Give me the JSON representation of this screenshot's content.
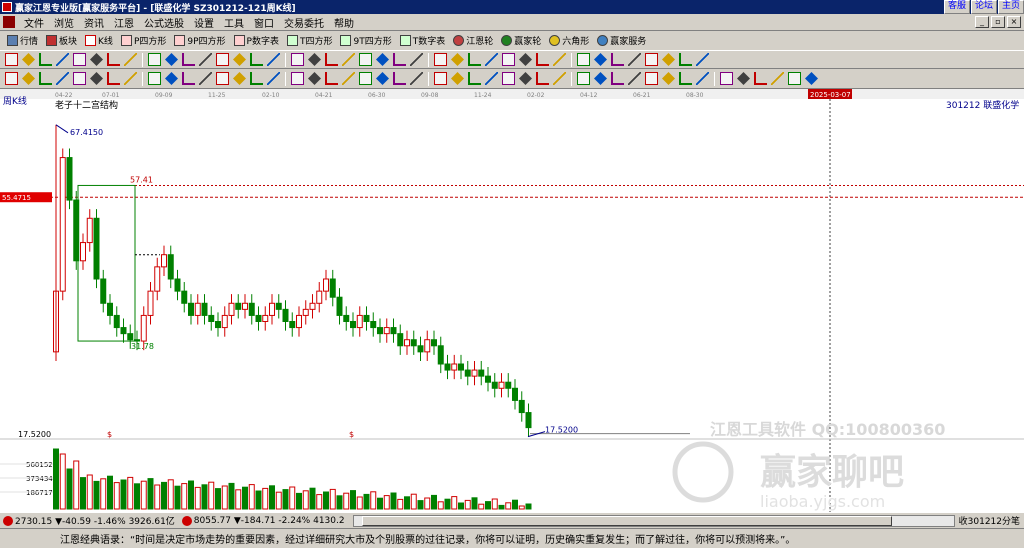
{
  "window": {
    "title": "赢家江恩专业版[赢家服务平台] - [联盛化学  SZ301212-121周K线]",
    "links": [
      "客服",
      "论坛",
      "主页"
    ]
  },
  "menu": [
    "文件",
    "浏览",
    "资讯",
    "江恩",
    "公式选股",
    "设置",
    "工具",
    "窗口",
    "交易委托",
    "帮助"
  ],
  "toolbar1": [
    "行情",
    "板块",
    "K线",
    "P四方形",
    "9P四方形",
    "P数字表",
    "T四方形",
    "9T四方形",
    "T数字表",
    "江恩轮",
    "赢家轮",
    "六角形",
    "赢家服务"
  ],
  "chart": {
    "period_label": "周K线",
    "study_title": "老子十二宫结构",
    "symbol_info": "301212  联盛化学",
    "cursor_date": "2025-03-07",
    "cursor_price": "55.4715",
    "high_label": "67.4150",
    "low_label": "17.5200",
    "box_top_label": "57.41",
    "box_bottom_label": "31.78",
    "bottom_price_label": "17.5200",
    "volume_labels": [
      "560152",
      "373434",
      "186717"
    ],
    "x_ticks": [
      "04-22",
      "07-01",
      "09-09",
      "11-25",
      "02-10",
      "04-21",
      "06-30",
      "09-08",
      "11-24",
      "02-02",
      "04-12",
      "06-21",
      "08-30"
    ],
    "watermark_line1": "江恩工具软件   QQ:100800360",
    "watermark_brand": "赢家聊吧",
    "watermark_sub": "liaoba.yjgs.com",
    "dollar_marks": [
      "$",
      "$"
    ]
  },
  "chart_data": {
    "type": "candlestick",
    "x_ticks": [
      "04-22",
      "07-01",
      "09-09",
      "11-25",
      "02-10",
      "04-21",
      "06-30",
      "09-08",
      "11-24",
      "02-02",
      "04-12",
      "06-21",
      "08-30"
    ],
    "high": 67.415,
    "low": 17.52,
    "levels": [
      57.41,
      31.78,
      17.52,
      55.4715
    ],
    "closes_approx": [
      40,
      62,
      55,
      45,
      48,
      52,
      42,
      38,
      36,
      34,
      33,
      32,
      31.78,
      36,
      40,
      44,
      46,
      42,
      40,
      38,
      36,
      38,
      36,
      35,
      34,
      36,
      38,
      37,
      38,
      36,
      35,
      36,
      38,
      37,
      35,
      34,
      36,
      37,
      38,
      40,
      42,
      39,
      36,
      35,
      34,
      36,
      35,
      34,
      33,
      34,
      33,
      31,
      32,
      31,
      30,
      32,
      31,
      28,
      27,
      28,
      27,
      26,
      27,
      26,
      25,
      24,
      25,
      24,
      22,
      20,
      17.52
    ]
  },
  "status": {
    "index1": "2730.15 ▼-40.59 -1.46% 3926.61亿",
    "index2": "8055.77 ▼-184.71 -2.24% 4130.2",
    "right_text": "收301212分笔"
  },
  "quote": "江恩经典语录：“时间是决定市场走势的重要因素，经过详细研究大市及个别股票的过往记录，你将可以证明，历史确实重复发生；而了解过往，你将可以预测将来。”。",
  "colors": {
    "up": "#d00000",
    "down": "#008000",
    "cursor": "#c00000",
    "box": "#008000",
    "accent": "#00008b"
  }
}
